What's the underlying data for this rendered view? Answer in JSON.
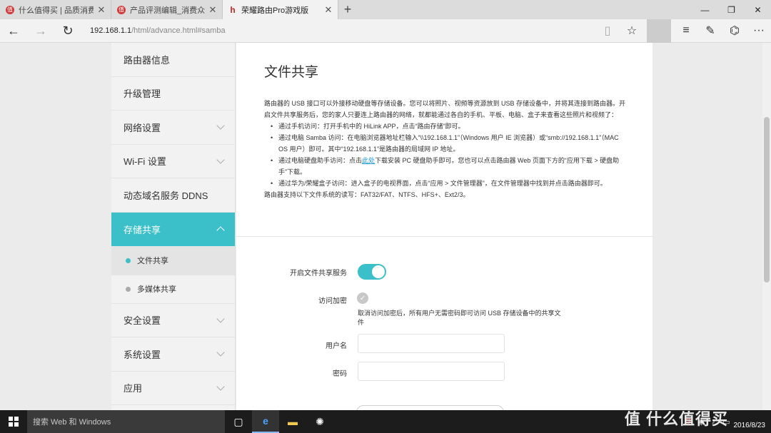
{
  "tabs": [
    {
      "icon": "值",
      "title": "什么值得买 | 品质消费第一站"
    },
    {
      "icon": "值",
      "title": "产品评测编辑_消费众测_什么值得买"
    },
    {
      "icon": "h",
      "title": "荣耀路由Pro游戏版"
    }
  ],
  "window_controls": {
    "minimize": "—",
    "maximize": "❐",
    "close": "✕"
  },
  "address": {
    "host": "192.168.1.1",
    "path": "/html/advance.html#samba"
  },
  "sidebar": {
    "items": [
      {
        "label": "路由器信息"
      },
      {
        "label": "升级管理"
      },
      {
        "label": "网络设置"
      },
      {
        "label": "Wi-Fi 设置"
      },
      {
        "label": "动态域名服务 DDNS"
      },
      {
        "label": "存储共享"
      }
    ],
    "subitems": [
      {
        "label": "文件共享"
      },
      {
        "label": "多媒体共享"
      }
    ],
    "items_after": [
      {
        "label": "安全设置"
      },
      {
        "label": "系统设置"
      },
      {
        "label": "应用"
      }
    ]
  },
  "main": {
    "title": "文件共享",
    "intro": "路由器的 USB 接口可以外接移动硬盘等存储设备。您可以将照片、视频等资源放到 USB 存储设备中，并将其连接到路由器。开启文件共享服务后，您的家人只要连上路由器的网络，就都能通过各自的手机、平板、电脑、盒子来查看这些照片和视频了：",
    "bullets": [
      "通过手机访问：打开手机中的 HiLink APP，点击“路由存储”即可。",
      "通过电脑 Samba 访问：在电脑浏览器地址栏输入“\\\\192.168.1.1”（Windows 用户 IE 浏览器）或“smb://192.168.1.1”（MAC OS 用户）即可。其中“192.168.1.1”是路由器的局域网 IP 地址。",
      "通过华为/荣耀盒子访问：进入盒子的电视界面，点击“应用 > 文件管理器”，在文件管理器中找到并点击路由器即可。"
    ],
    "bullet3_pre": "通过电脑硬盘助手访问：点击",
    "bullet3_link": "此处",
    "bullet3_post": "下载安装 PC 硬盘助手即可。您也可以点击路由器 Web 页面下方的“应用下载 > 硬盘助手”下载。",
    "fs_support": "路由器支持以下文件系统的读写：FAT32/FAT、NTFS、HFS+、Ext2/3。",
    "form": {
      "enable_label": "开启文件共享服务",
      "enable_on": true,
      "encrypt_label": "访问加密",
      "encrypt_hint": "取消访问加密后，所有用户无需密码即可访问 USB 存储设备中的共享文件",
      "username_label": "用户名",
      "username_value": "",
      "password_label": "密码",
      "password_value": ""
    }
  },
  "taskbar": {
    "search_placeholder": "搜索 Web 和 Windows",
    "date": "2016/8/23"
  },
  "watermark": "值 什么值得买",
  "colors": {
    "accent": "#3bbfc8",
    "link": "#1a9bd7"
  }
}
